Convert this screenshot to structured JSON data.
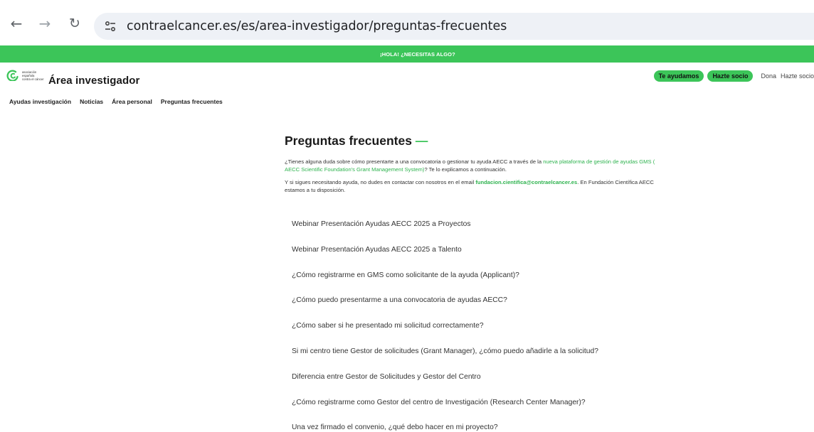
{
  "browser": {
    "url": "contraelcancer.es/es/area-investigador/preguntas-frecuentes"
  },
  "topbar": {
    "label": "¡HOLA! ¿NECESITAS ALGO?"
  },
  "header": {
    "logo_lines": [
      "asociación",
      "española",
      "contra el cáncer"
    ],
    "title": "Área investigador",
    "pills": [
      "Te ayudamos",
      "Hazte socio"
    ],
    "links": [
      "Dona",
      "Hazte socio"
    ]
  },
  "subnav": {
    "items": [
      "Ayudas investigación",
      "Noticias",
      "Área personal",
      "Preguntas frecuentes"
    ]
  },
  "main": {
    "title": "Preguntas frecuentes",
    "title_dash": "—",
    "intro1_a": "¿Tienes alguna duda sobre cómo presentarte a una convocatoria o gestionar tu ayuda AECC a través de la ",
    "intro1_link": "nueva plataforma de gestión de ayudas GMS ( AECC Scientific Foundation's Grant Management System)",
    "intro1_b": "? Te lo explicamos a continuación.",
    "intro2_a": "Y si sigues necesitando ayuda, no dudes en contactar con nosotros en el email ",
    "intro2_email": "fundacion.cientifica@contraelcancer.es",
    "intro2_b": ". En Fundación Científica AECC estamos a tu disposición."
  },
  "faq": [
    "Webinar Presentación Ayudas AECC 2025 a Proyectos",
    "Webinar Presentación Ayudas AECC 2025 a Talento",
    "¿Cómo registrarme en GMS como solicitante de la ayuda (Applicant)?",
    "¿Cómo puedo presentarme a una convocatoria de ayudas AECC?",
    "¿Cómo saber si he presentado mi solicitud correctamente?",
    "Si mi centro tiene Gestor de solicitudes (Grant Manager), ¿cómo puedo añadirle a la solicitud?",
    "Diferencia entre Gestor de Solicitudes y Gestor del Centro",
    "¿Cómo registrarme como Gestor del centro de Investigación (Research Center Manager)?",
    "Una vez firmado el convenio, ¿qué debo hacer en mi proyecto?"
  ],
  "colors": {
    "brand_green": "#3cc559",
    "link_green": "#2fb34f"
  }
}
